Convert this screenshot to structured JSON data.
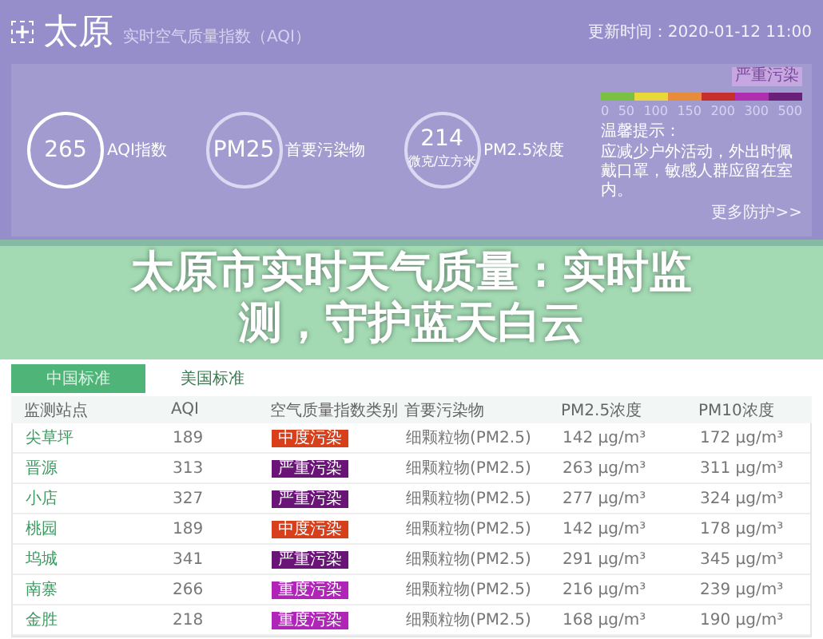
{
  "header": {
    "city": "太原",
    "subtitle": "实时空气质量指数（AQI）",
    "updated": "更新时间：2020-01-12 11:00"
  },
  "summary": {
    "metrics": [
      {
        "value": "265",
        "label": "AQI指数"
      },
      {
        "value": "PM25",
        "label": "首要污染物"
      },
      {
        "value": "214",
        "label": "PM2.5浓度",
        "unit": "微克/立方米"
      }
    ],
    "scale": {
      "current": "严重污染",
      "segments": [
        {
          "color": "#7ac143"
        },
        {
          "color": "#e8d83a"
        },
        {
          "color": "#e88c3a"
        },
        {
          "color": "#c7302a"
        },
        {
          "color": "#b02fb0"
        },
        {
          "color": "#6a1f78"
        }
      ],
      "ticks": [
        "0",
        "50",
        "100",
        "150",
        "200",
        "300",
        "500"
      ]
    },
    "tip_title": "温馨提示：",
    "tip": "应减少户外活动，外出时佩戴口罩，敏感人群应留在室内。",
    "more": "更多防护>>"
  },
  "headline": "太原市实时天气质量：实时监测，守护蓝天白云",
  "tabs": [
    {
      "label": "中国标准",
      "selected": true
    },
    {
      "label": "美国标准",
      "selected": false
    }
  ],
  "table": {
    "columns": [
      "监测站点",
      "AQI",
      "空气质量指数类别",
      "首要污染物",
      "PM2.5浓度",
      "PM10浓度"
    ],
    "rows": [
      {
        "station": "尖草坪",
        "aqi": "189",
        "category": "中度污染",
        "color": "#d8401c",
        "pollutant": "细颗粒物(PM2.5)",
        "pm25": "142 μg/m³",
        "pm10": "172 μg/m³"
      },
      {
        "station": "晋源",
        "aqi": "313",
        "category": "严重污染",
        "color": "#6a1478",
        "pollutant": "细颗粒物(PM2.5)",
        "pm25": "263 μg/m³",
        "pm10": "311 μg/m³"
      },
      {
        "station": "小店",
        "aqi": "327",
        "category": "严重污染",
        "color": "#6a1478",
        "pollutant": "细颗粒物(PM2.5)",
        "pm25": "277 μg/m³",
        "pm10": "324 μg/m³"
      },
      {
        "station": "桃园",
        "aqi": "189",
        "category": "中度污染",
        "color": "#d8401c",
        "pollutant": "细颗粒物(PM2.5)",
        "pm25": "142 μg/m³",
        "pm10": "178 μg/m³"
      },
      {
        "station": "坞城",
        "aqi": "341",
        "category": "严重污染",
        "color": "#6a1478",
        "pollutant": "细颗粒物(PM2.5)",
        "pm25": "291 μg/m³",
        "pm10": "345 μg/m³"
      },
      {
        "station": "南寨",
        "aqi": "266",
        "category": "重度污染",
        "color": "#b024b8",
        "pollutant": "细颗粒物(PM2.5)",
        "pm25": "216 μg/m³",
        "pm10": "239 μg/m³"
      },
      {
        "station": "金胜",
        "aqi": "218",
        "category": "重度污染",
        "color": "#b024b8",
        "pollutant": "细颗粒物(PM2.5)",
        "pm25": "168 μg/m³",
        "pm10": "190 μg/m³"
      }
    ]
  }
}
